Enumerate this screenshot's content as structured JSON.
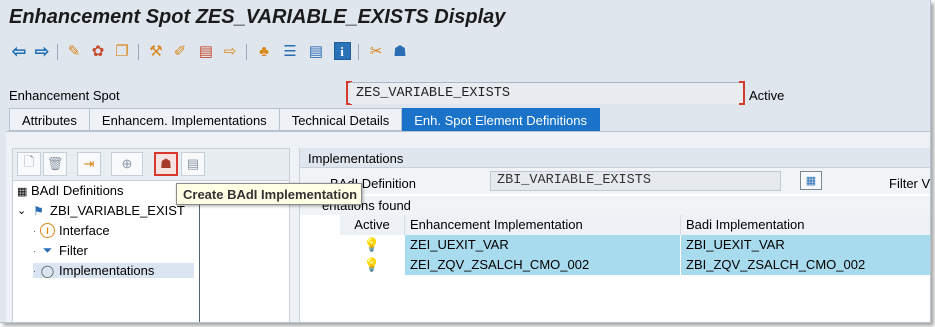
{
  "window": {
    "title": "Enhancement Spot ZES_VARIABLE_EXISTS Display"
  },
  "toolbar": {
    "icons": [
      "back-arrow-icon",
      "forward-arrow-icon",
      "other-object-icon",
      "display-change-icon",
      "activate-icon",
      "check-icon",
      "where-used-icon",
      "transport-icon",
      "hierarchy-icon",
      "enhancement-info-icon",
      "documentation-icon",
      "info-icon",
      "badi-icon",
      "implementations-icon"
    ]
  },
  "spot": {
    "label": "Enhancement Spot",
    "value": "ZES_VARIABLE_EXISTS",
    "status": "Active"
  },
  "tabs": [
    {
      "label": "Attributes"
    },
    {
      "label": "Enhancem. Implementations"
    },
    {
      "label": "Technical Details"
    },
    {
      "label": "Enh. Spot Element Definitions",
      "active": true
    }
  ],
  "left": {
    "heading": "BAdI Definitions",
    "tree": [
      {
        "label": "ZBI_VARIABLE_EXIST",
        "expander": "⌄"
      },
      {
        "label": "Interface"
      },
      {
        "label": "Filter"
      },
      {
        "label": "Implementations"
      }
    ],
    "tooltip": "Create BAdI Implementation"
  },
  "right": {
    "title": "Implementations",
    "badi_def_label": "BAdI Definition",
    "badi_def_value": "ZBI_VARIABLE_EXISTS",
    "filter_label": "Filter V",
    "found_label": "entations found",
    "columns": [
      "Active",
      "Enhancement Implementation",
      "Badi Implementation"
    ],
    "rows": [
      {
        "enh_impl": "ZEI_UEXIT_VAR",
        "badi_impl": "ZBI_UEXIT_VAR"
      },
      {
        "enh_impl": "ZEI_ZQV_ZSALCH_CMO_002",
        "badi_impl": "ZBI_ZQV_ZSALCH_CMO_002"
      }
    ]
  }
}
